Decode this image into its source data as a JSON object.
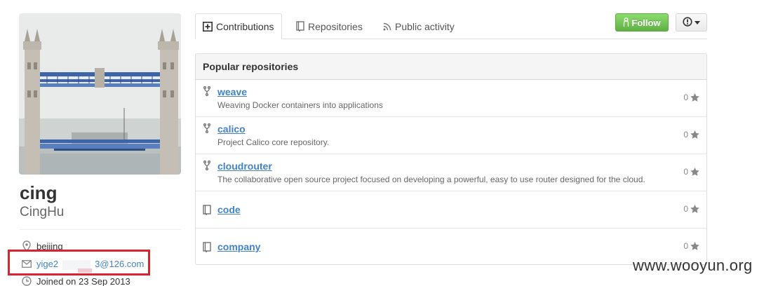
{
  "profile": {
    "fullname": "cing",
    "username": "CingHu",
    "location": "beijing",
    "email": "yige2    3@126.com",
    "joined": "Joined on 23 Sep 2013"
  },
  "tabs": [
    {
      "label": "Contributions",
      "icon": "contributions-icon",
      "selected": true
    },
    {
      "label": "Repositories",
      "icon": "repo-book-icon",
      "selected": false
    },
    {
      "label": "Public activity",
      "icon": "rss-icon",
      "selected": false
    }
  ],
  "actions": {
    "follow_label": "Follow",
    "more_icon": "alert-caret-icon"
  },
  "popular": {
    "title": "Popular repositories",
    "repos": [
      {
        "name": "weave",
        "desc": "Weaving Docker containers into applications",
        "stars": "0",
        "type": "fork"
      },
      {
        "name": "calico",
        "desc": "Project Calico core repository.",
        "stars": "0",
        "type": "fork"
      },
      {
        "name": "cloudrouter",
        "desc": "The collaborative open source project focused on developing a powerful, easy to use router designed for the cloud.",
        "stars": "0",
        "type": "fork"
      },
      {
        "name": "code",
        "desc": "",
        "stars": "0",
        "type": "source"
      },
      {
        "name": "company",
        "desc": "",
        "stars": "0",
        "type": "source"
      }
    ]
  },
  "watermark": "www.wooyun.org",
  "colors": {
    "link": "#4183c4",
    "follow_green": "#60b044",
    "highlight_red": "#d9232e"
  }
}
